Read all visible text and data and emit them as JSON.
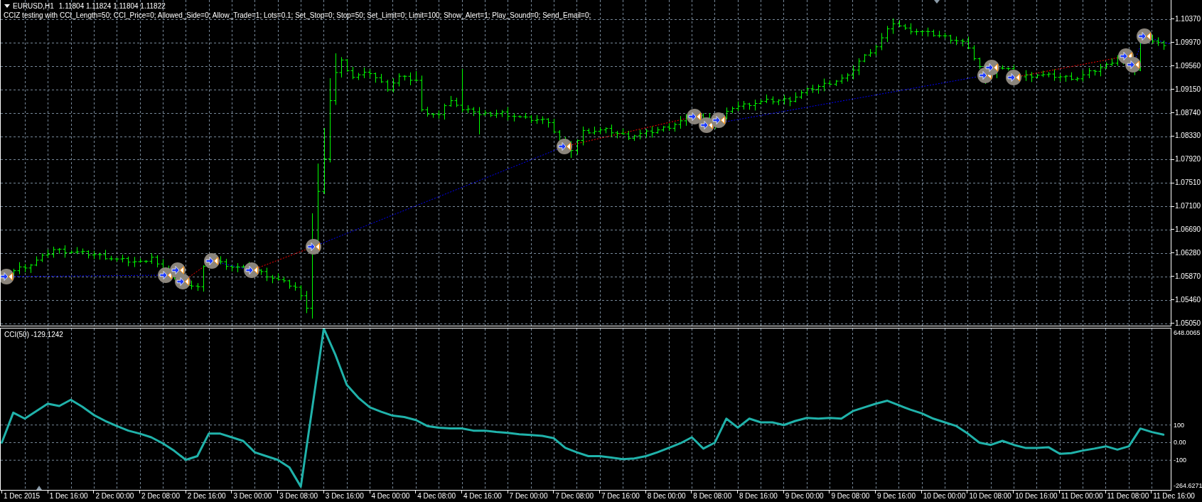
{
  "chart_header": {
    "symbol": "EURUSD,H1",
    "quote": "1.11804 1.11824 1.11804 1.11822",
    "expert_comment": "CCIZ testing with CCI_Length=50; CCI_Price=0; Allowed_Side=0; Allow_Trade=1; Lots=0.1; Set_Stop=0; Stop=50; Set_Limit=0; Limit=100; Show_Alert=1; Play_Sound=0; Send_Email=0;"
  },
  "price_axis": [
    "1.10370",
    "1.09970",
    "1.09560",
    "1.09150",
    "1.08740",
    "1.08330",
    "1.07920",
    "1.07510",
    "1.07100",
    "1.06690",
    "1.06280",
    "1.05870",
    "1.05460",
    "1.05050"
  ],
  "indicator_panel": {
    "scale_max_label": "648.0065",
    "scale_min_label": "-264.6271",
    "chart_data": {
      "type": "line",
      "title": "CCI(50) -129.1242",
      "grid": true,
      "ylim": [
        -264.6271,
        648.0065
      ],
      "yticks": [
        {
          "value": 100,
          "label": "100"
        },
        {
          "value": 0,
          "label": "0.00"
        },
        {
          "value": -100,
          "label": "-100"
        }
      ],
      "series": [
        {
          "color": "#20b2aa",
          "values": [
            0,
            170,
            136,
            179,
            221,
            208,
            243,
            204,
            157,
            123,
            94,
            68,
            51,
            30,
            -4,
            -47,
            -98,
            -77,
            51,
            51,
            30,
            9,
            -55,
            -77,
            -98,
            -140,
            -250,
            200,
            648,
            500,
            328,
            255,
            200,
            175,
            153,
            145,
            128,
            94,
            85,
            81,
            81,
            68,
            68,
            60,
            55,
            47,
            43,
            38,
            25,
            -30,
            -55,
            -77,
            -77,
            -85,
            -94,
            -90,
            -77,
            -55,
            -30,
            -4,
            30,
            -34,
            0,
            136,
            85,
            136,
            115,
            115,
            100,
            123,
            140,
            136,
            140,
            136,
            179,
            200,
            221,
            238,
            212,
            187,
            166,
            136,
            115,
            94,
            51,
            0,
            -13,
            10,
            -13,
            -30,
            -30,
            -26,
            -64,
            -60,
            -45,
            -34,
            -21,
            -40,
            -21,
            80,
            60,
            45
          ]
        }
      ]
    }
  },
  "time_axis": [
    "1 Dec 2015",
    "1 Dec 16:00",
    "2 Dec 00:00",
    "2 Dec 08:00",
    "2 Dec 16:00",
    "3 Dec 00:00",
    "3 Dec 08:00",
    "3 Dec 16:00",
    "4 Dec 00:00",
    "4 Dec 08:00",
    "4 Dec 16:00",
    "7 Dec 00:00",
    "7 Dec 08:00",
    "7 Dec 16:00",
    "8 Dec 00:00",
    "8 Dec 08:00",
    "8 Dec 16:00",
    "9 Dec 00:00",
    "9 Dec 08:00",
    "9 Dec 16:00",
    "10 Dec 00:00",
    "10 Dec 08:00",
    "10 Dec 16:00",
    "11 Dec 00:00",
    "11 Dec 08:00",
    "11 Dec 16:00"
  ]
}
